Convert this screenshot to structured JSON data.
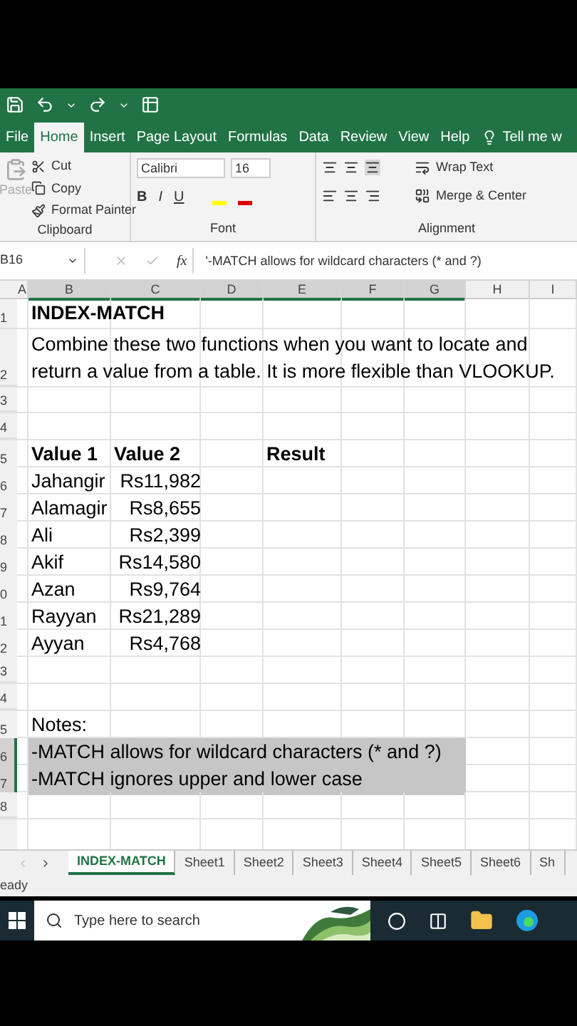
{
  "ribbon_tabs": [
    {
      "label": "File",
      "selected": false
    },
    {
      "label": "Home",
      "selected": true
    },
    {
      "label": "Insert",
      "selected": false
    },
    {
      "label": "Page Layout",
      "selected": false
    },
    {
      "label": "Formulas",
      "selected": false
    },
    {
      "label": "Data",
      "selected": false
    },
    {
      "label": "Review",
      "selected": false
    },
    {
      "label": "View",
      "selected": false
    },
    {
      "label": "Help",
      "selected": false
    }
  ],
  "tell_me": "Tell me w",
  "clipboard": {
    "paste": "Paste",
    "cut": "Cut",
    "copy": "Copy",
    "format_painter": "Format Painter",
    "label": "Clipboard"
  },
  "font": {
    "name": "Calibri",
    "size": "16",
    "bold": "B",
    "italic": "I",
    "underline": "U",
    "label": "Font"
  },
  "alignment": {
    "wrap_text": "Wrap Text",
    "merge": "Merge & Center",
    "label": "Alignment"
  },
  "formula_bar": {
    "name_box": "B16",
    "fx": "fx",
    "content": "'-MATCH allows for wildcard characters (* and ?)"
  },
  "columns": [
    {
      "label": "A",
      "selected": false
    },
    {
      "label": "B",
      "selected": true
    },
    {
      "label": "C",
      "selected": true
    },
    {
      "label": "D",
      "selected": true
    },
    {
      "label": "E",
      "selected": true
    },
    {
      "label": "F",
      "selected": true
    },
    {
      "label": "G",
      "selected": true
    },
    {
      "label": "H",
      "selected": false
    },
    {
      "label": "I",
      "selected": false
    }
  ],
  "rows": [
    {
      "number": "1",
      "selected": false,
      "cells": {
        "B": {
          "text": "INDEX-MATCH",
          "bold": true,
          "kind": "text"
        }
      }
    },
    {
      "number": "2",
      "selected": false,
      "cells": {
        "B": {
          "text": "Combine these two functions when you want to locate and return a value from a table.  It is more flexible than VLOOKUP.",
          "bold": false,
          "kind": "wrap"
        }
      }
    },
    {
      "number": "3",
      "selected": false
    },
    {
      "number": "4",
      "selected": false
    },
    {
      "number": "5",
      "selected": false,
      "cells": {
        "B": {
          "text": "Value 1",
          "bold": true,
          "kind": "text"
        },
        "C": {
          "text": "Value 2",
          "bold": true,
          "kind": "text"
        },
        "E": {
          "text": "Result",
          "bold": true,
          "kind": "text"
        }
      }
    },
    {
      "number": "6",
      "selected": false,
      "cells": {
        "B": {
          "text": "Jahangir",
          "bold": false,
          "kind": "text"
        },
        "C": {
          "text": "Rs11,982",
          "bold": false,
          "kind": "number"
        }
      }
    },
    {
      "number": "7",
      "selected": false,
      "cells": {
        "B": {
          "text": "Alamagir",
          "bold": false,
          "kind": "text"
        },
        "C": {
          "text": "Rs8,655",
          "bold": false,
          "kind": "number"
        }
      }
    },
    {
      "number": "8",
      "selected": false,
      "cells": {
        "B": {
          "text": "Ali",
          "bold": false,
          "kind": "text"
        },
        "C": {
          "text": "Rs2,399",
          "bold": false,
          "kind": "number"
        }
      }
    },
    {
      "number": "9",
      "selected": false,
      "cells": {
        "B": {
          "text": "Akif",
          "bold": false,
          "kind": "text"
        },
        "C": {
          "text": "Rs14,580",
          "bold": false,
          "kind": "number"
        }
      }
    },
    {
      "number": "0",
      "selected": false,
      "cells": {
        "B": {
          "text": "Azan",
          "bold": false,
          "kind": "text"
        },
        "C": {
          "text": "Rs9,764",
          "bold": false,
          "kind": "number"
        }
      }
    },
    {
      "number": "1",
      "selected": false,
      "cells": {
        "B": {
          "text": "Rayyan",
          "bold": false,
          "kind": "text"
        },
        "C": {
          "text": "Rs21,289",
          "bold": false,
          "kind": "number"
        }
      }
    },
    {
      "number": "2",
      "selected": false,
      "cells": {
        "B": {
          "text": "Ayyan",
          "bold": false,
          "kind": "text"
        },
        "C": {
          "text": "Rs4,768",
          "bold": false,
          "kind": "number"
        }
      }
    },
    {
      "number": "3",
      "selected": false
    },
    {
      "number": "4",
      "selected": false
    },
    {
      "number": "5",
      "selected": false,
      "cells": {
        "B": {
          "text": "Notes:",
          "bold": false,
          "kind": "text"
        }
      }
    },
    {
      "number": "6",
      "selected": true,
      "cells": {
        "B": {
          "text": "-MATCH allows for wildcard characters (* and ?)",
          "bold": false,
          "kind": "text"
        }
      }
    },
    {
      "number": "7",
      "selected": true,
      "cells": {
        "B": {
          "text": "-MATCH ignores upper and lower case",
          "bold": false,
          "kind": "text"
        }
      }
    },
    {
      "number": "8",
      "selected": false
    }
  ],
  "sheet_tabs": [
    {
      "label": "INDEX-MATCH",
      "selected": true
    },
    {
      "label": "Sheet1",
      "selected": false
    },
    {
      "label": "Sheet2",
      "selected": false
    },
    {
      "label": "Sheet3",
      "selected": false
    },
    {
      "label": "Sheet4",
      "selected": false
    },
    {
      "label": "Sheet5",
      "selected": false
    },
    {
      "label": "Sheet6",
      "selected": false
    },
    {
      "label": "Sh",
      "selected": false
    }
  ],
  "status_bar": "eady",
  "taskbar": {
    "search": {
      "placeholder": "Type here to search"
    }
  }
}
